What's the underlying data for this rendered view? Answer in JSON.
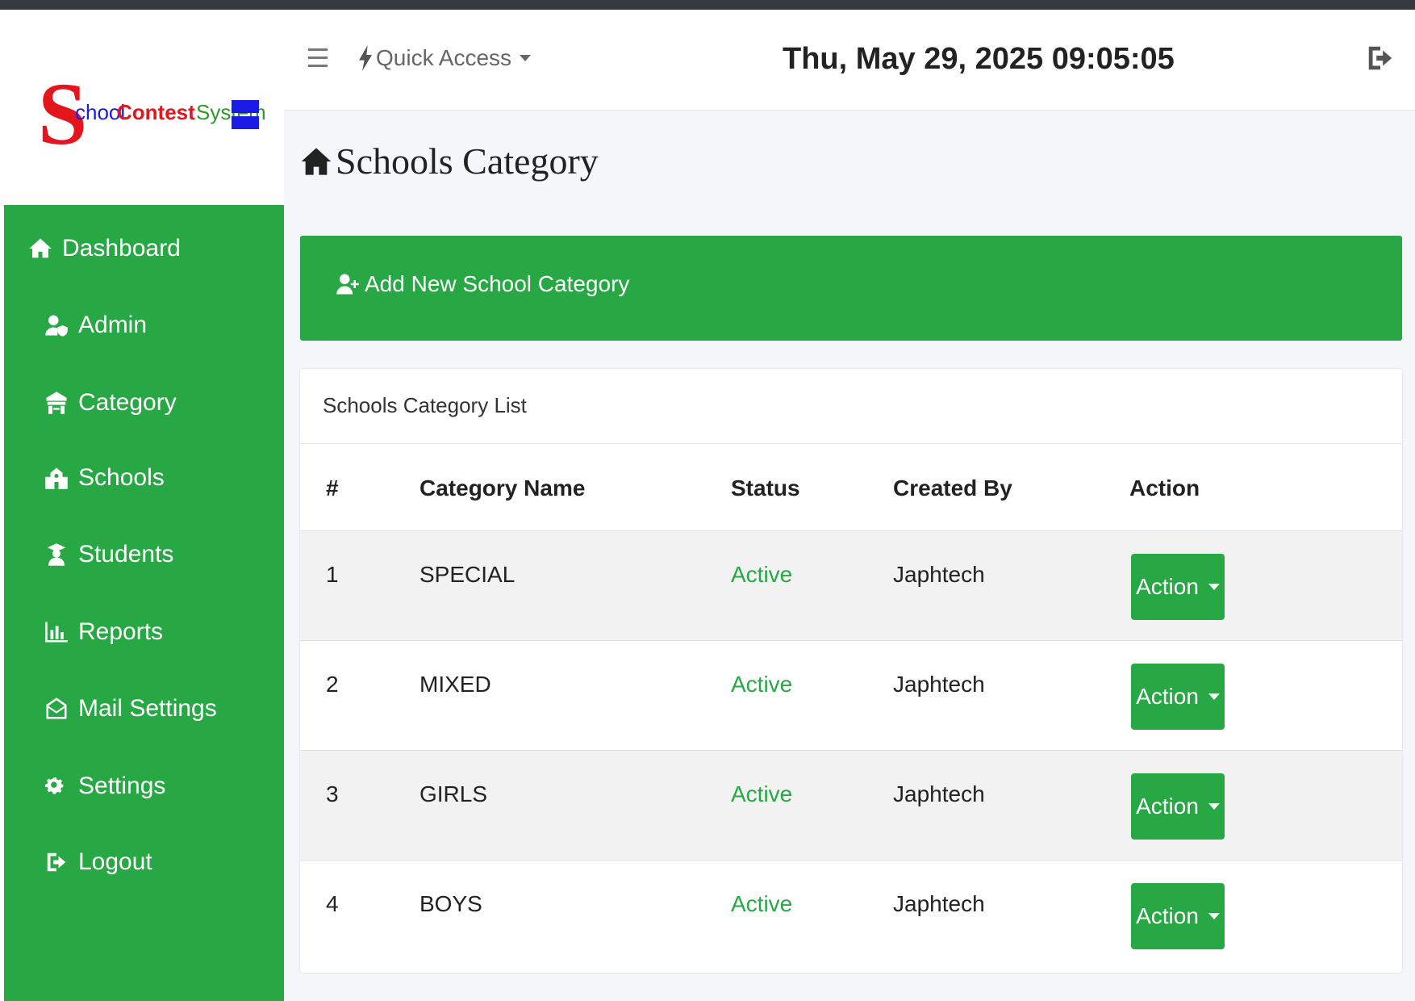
{
  "brand": {
    "logo_text_s": "S",
    "logo_text_chool": "chool",
    "logo_text_contest": "Contest",
    "logo_text_system": "System"
  },
  "sidebar": {
    "items": [
      {
        "label": "Dashboard",
        "icon": "home-icon"
      },
      {
        "label": "Admin",
        "icon": "user-shield-icon"
      },
      {
        "label": "Category",
        "icon": "gate-icon"
      },
      {
        "label": "Schools",
        "icon": "school-icon"
      },
      {
        "label": "Students",
        "icon": "graduate-icon"
      },
      {
        "label": "Reports",
        "icon": "bar-chart-icon"
      },
      {
        "label": "Mail Settings",
        "icon": "envelope-open-icon"
      },
      {
        "label": "Settings",
        "icon": "gears-icon"
      },
      {
        "label": "Logout",
        "icon": "sign-out-icon"
      }
    ]
  },
  "header": {
    "quick_access": "Quick Access",
    "datetime": "Thu, May 29, 2025 09:05:05"
  },
  "page": {
    "title": "Schools Category",
    "add_button": "Add New School Category",
    "card_title": "Schools Category List"
  },
  "table": {
    "headers": [
      "#",
      "Category Name",
      "Status",
      "Created By",
      "Action"
    ],
    "rows": [
      {
        "num": "1",
        "name": "SPECIAL",
        "status": "Active",
        "created_by": "Japhtech",
        "action": "Action"
      },
      {
        "num": "2",
        "name": "MIXED",
        "status": "Active",
        "created_by": "Japhtech",
        "action": "Action"
      },
      {
        "num": "3",
        "name": "GIRLS",
        "status": "Active",
        "created_by": "Japhtech",
        "action": "Action"
      },
      {
        "num": "4",
        "name": "BOYS",
        "status": "Active",
        "created_by": "Japhtech",
        "action": "Action"
      }
    ]
  },
  "colors": {
    "primary_green": "#28a745",
    "dark_bar": "#343a40",
    "logo_red": "#e3161e",
    "logo_green": "#2e9a2e",
    "logo_blue": "#1a1ae6"
  }
}
